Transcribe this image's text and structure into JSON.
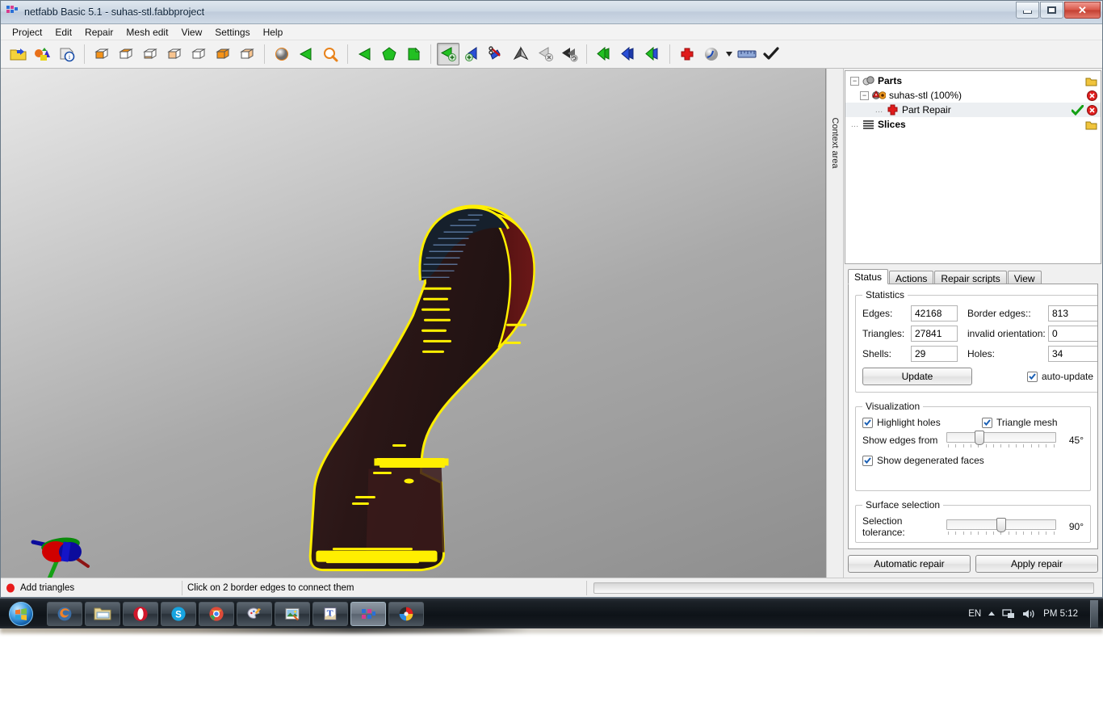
{
  "window": {
    "title": "netfabb Basic 5.1 - suhas-stl.fabbproject",
    "app_icon": "netfabb-logo-icon",
    "minimize_label": "–",
    "maximize_label": "❐",
    "close_label": "✕"
  },
  "menubar": {
    "items": [
      {
        "label": "Project"
      },
      {
        "label": "Edit"
      },
      {
        "label": "Repair"
      },
      {
        "label": "Mesh edit"
      },
      {
        "label": "View"
      },
      {
        "label": "Settings"
      },
      {
        "label": "Help"
      }
    ]
  },
  "toolbar": {
    "groups": [
      {
        "buttons": [
          {
            "name": "open-project-icon",
            "title": "Open project"
          },
          {
            "name": "add-part-icon",
            "title": "Add part"
          },
          {
            "name": "part-info-icon",
            "title": "Part information"
          }
        ]
      },
      {
        "buttons": [
          {
            "name": "view-iso-icon",
            "title": "Isometric view"
          },
          {
            "name": "view-top-icon",
            "title": "Top view"
          },
          {
            "name": "view-bottom-icon",
            "title": "Bottom view"
          },
          {
            "name": "view-front-icon",
            "title": "Front view"
          },
          {
            "name": "view-back-icon",
            "title": "Back view"
          },
          {
            "name": "view-left-icon",
            "title": "Left view"
          },
          {
            "name": "view-right-icon",
            "title": "Right view"
          }
        ]
      },
      {
        "buttons": [
          {
            "name": "shading-icon",
            "title": "Shading"
          },
          {
            "name": "select-triangle-icon",
            "title": "Select triangle"
          },
          {
            "name": "zoom-icon",
            "title": "Zoom"
          }
        ]
      },
      {
        "buttons": [
          {
            "name": "select-surface-icon",
            "title": "Select surface"
          },
          {
            "name": "select-shell-icon",
            "title": "Select shell"
          },
          {
            "name": "select-all-icon",
            "title": "Select all"
          }
        ]
      },
      {
        "buttons": [
          {
            "name": "add-triangles-icon",
            "title": "Add triangles",
            "active": true
          },
          {
            "name": "add-triangle-fan-icon",
            "title": "Add triangle fan"
          },
          {
            "name": "split-triangles-icon",
            "title": "Split triangles"
          },
          {
            "name": "tunnel-icon",
            "title": "Close tunnel"
          },
          {
            "name": "remove-triangle-icon",
            "title": "Remove triangle"
          },
          {
            "name": "flip-triangles-icon",
            "title": "Flip triangles"
          }
        ]
      },
      {
        "buttons": [
          {
            "name": "triangle-green-icon",
            "title": "Triangles"
          },
          {
            "name": "triangle-blue-icon",
            "title": "Invert"
          },
          {
            "name": "triangle-mixed-icon",
            "title": "Mesh"
          }
        ]
      },
      {
        "buttons": [
          {
            "name": "repair-cross-icon",
            "title": "Repair part"
          },
          {
            "name": "analysis-icon",
            "title": "Analysis"
          },
          {
            "name": "analysis-dropdown-icon",
            "title": "Analysis options"
          },
          {
            "name": "measure-icon",
            "title": "Measure"
          },
          {
            "name": "apply-check-icon",
            "title": "Apply repair"
          }
        ]
      }
    ]
  },
  "viewport": {
    "context_tab_label": "Context area",
    "axis_gizmo": {
      "name": "axis-gizmo",
      "colors": [
        "#cc0000",
        "#00aa00",
        "#0000cc"
      ]
    },
    "model": {
      "name": "suhas-stl",
      "body_color": "#2a1818",
      "highlight_color": "#ffef00",
      "back_face_color": "#5a1212",
      "edge_color": "#3f5f8f"
    }
  },
  "tree": {
    "nodes": [
      {
        "label": "Parts",
        "level": 0,
        "bold": true,
        "expander": "−",
        "icon": "parts-icon",
        "right_icons": [
          "folder-open-icon"
        ],
        "selected": false
      },
      {
        "label": "suhas-stl (100%)",
        "level": 1,
        "bold": false,
        "expander": "−",
        "icon": "part-warning-icon",
        "right_icons": [
          "remove-icon"
        ],
        "selected": false
      },
      {
        "label": "Part Repair",
        "level": 2,
        "bold": false,
        "expander": "",
        "icon": "repair-cross-icon",
        "right_icons": [
          "check-icon",
          "remove-icon"
        ],
        "selected": true
      },
      {
        "label": "Slices",
        "level": 0,
        "bold": true,
        "expander": "",
        "icon": "slices-icon",
        "right_icons": [
          "folder-open-icon"
        ],
        "selected": false
      }
    ]
  },
  "panel": {
    "tabs": [
      {
        "label": "Status",
        "active": true
      },
      {
        "label": "Actions",
        "active": false
      },
      {
        "label": "Repair scripts",
        "active": false
      },
      {
        "label": "View",
        "active": false
      }
    ],
    "statistics": {
      "legend": "Statistics",
      "rows": [
        {
          "left_label": "Edges:",
          "left_value": "42168",
          "right_label": "Border edges::",
          "right_value": "813"
        },
        {
          "left_label": "Triangles:",
          "left_value": "27841",
          "right_label": "invalid orientation:",
          "right_value": "0"
        },
        {
          "left_label": "Shells:",
          "left_value": "29",
          "right_label": "Holes:",
          "right_value": "34"
        }
      ],
      "update_button": "Update",
      "auto_update_label": "auto-update",
      "auto_update_checked": true
    },
    "visualization": {
      "legend": "Visualization",
      "highlight_holes_label": "Highlight holes",
      "highlight_holes_checked": true,
      "triangle_mesh_label": "Triangle mesh",
      "triangle_mesh_checked": true,
      "show_edges_label": "Show edges from",
      "show_edges_value": "45°",
      "show_edges_percent": 30,
      "degenerated_label": "Show degenerated faces",
      "degenerated_checked": true
    },
    "surface_selection": {
      "legend": "Surface selection",
      "tolerance_label": "Selection tolerance:",
      "tolerance_value": "90°",
      "tolerance_percent": 50
    },
    "buttons": {
      "automatic_repair": "Automatic repair",
      "apply_repair": "Apply repair"
    }
  },
  "statusbar": {
    "mode_icon": "red-dot-icon",
    "mode_label": "Add triangles",
    "hint": "Click on 2 border edges to connect them",
    "progress_percent": 0
  },
  "taskbar": {
    "start_label": "start-orb-icon",
    "items": [
      {
        "name": "taskbar-firefox",
        "icon": "firefox-icon",
        "active": false
      },
      {
        "name": "taskbar-explorer",
        "icon": "folder-icon",
        "active": false
      },
      {
        "name": "taskbar-opera",
        "icon": "opera-icon",
        "active": false
      },
      {
        "name": "taskbar-skype",
        "icon": "skype-icon",
        "active": false
      },
      {
        "name": "taskbar-chrome",
        "icon": "chrome-icon",
        "active": false
      },
      {
        "name": "taskbar-paint",
        "icon": "paint-icon",
        "active": false
      },
      {
        "name": "taskbar-photo",
        "icon": "photo-viewer-icon",
        "active": false
      },
      {
        "name": "taskbar-word",
        "icon": "document-icon",
        "active": false
      },
      {
        "name": "taskbar-netfabb",
        "icon": "netfabb-icon",
        "active": true
      },
      {
        "name": "taskbar-media",
        "icon": "media-icon",
        "active": false
      }
    ],
    "tray": {
      "language": "EN",
      "overflow_icon": "chevron-up-icon",
      "network_icon": "network-icon",
      "volume_icon": "volume-icon",
      "clock": "PM 5:12"
    }
  }
}
